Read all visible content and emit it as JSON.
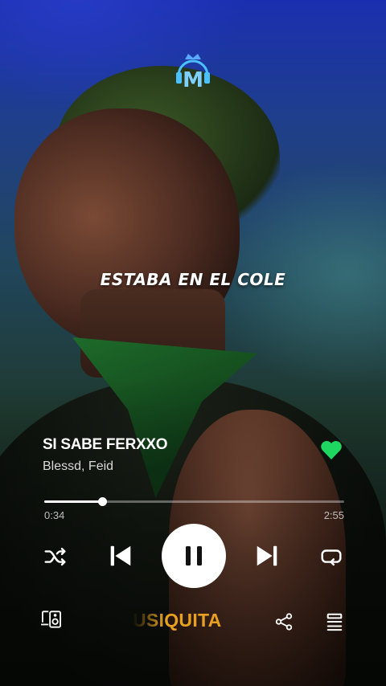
{
  "lyric": "ESTABA EN EL COLE",
  "track": {
    "title": "SI SABE FERXXO",
    "artist": "Blessd, Feid",
    "liked": true
  },
  "progress": {
    "elapsed": "0:34",
    "total": "2:55",
    "fraction": 0.194
  },
  "controls": {
    "shuffle": "shuffle-icon",
    "previous": "skip-previous-icon",
    "play_pause": "pause-icon",
    "next": "skip-next-icon",
    "repeat": "repeat-icon"
  },
  "bottom_bar": {
    "devices": "devices-icon",
    "watermark": "USIQUITA",
    "share": "share-icon",
    "queue": "queue-icon"
  },
  "colors": {
    "accent": "#1ed760",
    "watermark": "#e8a020",
    "play_button": "#ffffff"
  }
}
